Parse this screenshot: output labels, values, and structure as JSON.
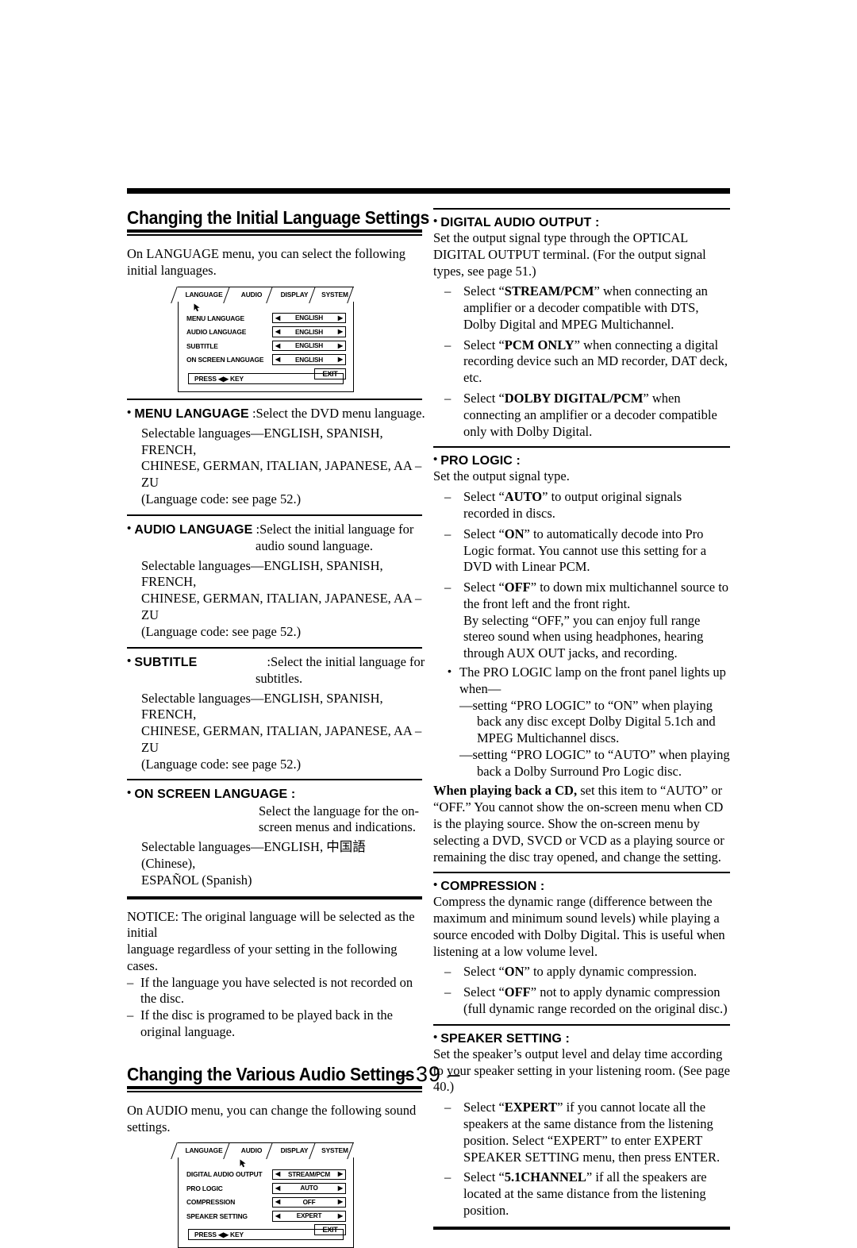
{
  "page": {
    "number_label": "– 39 –"
  },
  "left_column": {
    "heading": "Changing the Initial Language Settings",
    "intro": "On LANGUAGE menu, you can select the following initial languages.",
    "osd_language": {
      "tabs": [
        "LANGUAGE",
        "AUDIO",
        "DISPLAY",
        "SYSTEM"
      ],
      "active_tab": "LANGUAGE",
      "rows": [
        {
          "label": "MENU LANGUAGE",
          "value": "ENGLISH"
        },
        {
          "label": "AUDIO LANGUAGE",
          "value": "ENGLISH"
        },
        {
          "label": "SUBTITLE",
          "value": "ENGLISH"
        },
        {
          "label": "ON SCREEN LANGUAGE",
          "value": "ENGLISH"
        }
      ],
      "exit_label": "EXIT",
      "footer": "PRESS ◀▶ KEY",
      "left_arrow": "◀",
      "right_arrow": "▶"
    },
    "entries": [
      {
        "bullet": "•",
        "term": "MENU LANGUAGE",
        "defn": ":Select the DVD menu language.",
        "defn_cont": "",
        "list_line1": "Selectable languages—ENGLISH, SPANISH, FRENCH,",
        "list_line2": "CHINESE, GERMAN, ITALIAN, JAPANESE, AA – ZU",
        "list_line3": "(Language code: see page 52.)"
      },
      {
        "bullet": "•",
        "term": "AUDIO LANGUAGE",
        "defn": ":Select the initial language for",
        "defn_cont": "audio sound language.",
        "list_line1": "Selectable languages—ENGLISH, SPANISH, FRENCH,",
        "list_line2": "CHINESE, GERMAN, ITALIAN, JAPANESE, AA – ZU",
        "list_line3": "(Language code: see page 52.)"
      },
      {
        "bullet": "•",
        "term": "SUBTITLE",
        "defn": ":Select the initial language for",
        "defn_cont": "subtitles.",
        "list_line1": "Selectable languages—ENGLISH, SPANISH, FRENCH,",
        "list_line2": "CHINESE, GERMAN, ITALIAN, JAPANESE, AA – ZU",
        "list_line3": "(Language code: see page 52.)"
      }
    ],
    "on_screen_language": {
      "bullet": "•",
      "term": "ON SCREEN LANGUAGE :",
      "defn_line1": "Select the language for the on-",
      "defn_line2": "screen menus and indications.",
      "list_line1": "Selectable languages—ENGLISH, 中国語 (Chinese),",
      "list_line2": "ESPAÑOL (Spanish)"
    },
    "notice": {
      "line1": "NOTICE: The original language will be selected as the initial",
      "line2": "language regardless of your setting in the following cases.",
      "items": [
        {
          "dash": "–",
          "text": "If the language you have selected is not recorded on the disc."
        },
        {
          "dash": "–",
          "text": "If the disc is programed to be played back in the original language."
        }
      ]
    },
    "heading2": "Changing the Various Audio Settings",
    "intro2": "On AUDIO menu, you can change the following sound settings.",
    "osd_audio": {
      "tabs": [
        "LANGUAGE",
        "AUDIO",
        "DISPLAY",
        "SYSTEM"
      ],
      "active_tab": "AUDIO",
      "rows": [
        {
          "label": "DIGITAL AUDIO OUTPUT",
          "value": "STREAM/PCM"
        },
        {
          "label": "PRO LOGIC",
          "value": "AUTO"
        },
        {
          "label": "COMPRESSION",
          "value": "OFF"
        },
        {
          "label": "SPEAKER SETTING",
          "value": "EXPERT"
        }
      ],
      "exit_label": "EXIT",
      "footer": "PRESS ◀▶ KEY",
      "left_arrow": "◀",
      "right_arrow": "▶"
    }
  },
  "right_column": {
    "digital_audio_output": {
      "bullet": "•",
      "title": "DIGITAL AUDIO OUTPUT :",
      "body": "Set the output signal type through the OPTICAL DIGITAL OUTPUT terminal. (For the output signal types, see page 51.)",
      "items": [
        {
          "dash": "–",
          "pre": "Select “",
          "strong": "STREAM/PCM",
          "post": "” when connecting an amplifier or a decoder compatible with DTS, Dolby Digital and MPEG Multichannel."
        },
        {
          "dash": "–",
          "pre": "Select “",
          "strong": "PCM ONLY",
          "post": "” when connecting a digital recording device such an MD recorder, DAT deck, etc."
        },
        {
          "dash": "–",
          "pre": "Select “",
          "strong": "DOLBY DIGITAL/PCM",
          "post": "” when connecting an amplifier or a decoder compatible only with Dolby Digital."
        }
      ]
    },
    "pro_logic": {
      "bullet": "•",
      "title": "PRO LOGIC :",
      "body": "Set the output signal type.",
      "items": [
        {
          "dash": "–",
          "pre": "Select “",
          "strong": "AUTO",
          "post": "” to output original signals recorded in discs."
        },
        {
          "dash": "–",
          "pre": "Select “",
          "strong": "ON",
          "post": "” to automatically decode into Pro Logic format. You cannot use this setting for a DVD with Linear PCM."
        },
        {
          "dash": "–",
          "pre": "Select “",
          "strong": "OFF",
          "post": "” to down mix multichannel source to the front left and the front right."
        }
      ],
      "off_note": "By selecting “OFF,” you can enjoy full range stereo sound when using headphones, hearing through AUX OUT jacks, and recording.",
      "lamp_bullet": "•",
      "lamp_note": "The PRO LOGIC lamp on the front panel lights up when—",
      "lamp_items": [
        "—setting “PRO LOGIC” to “ON” when playing back any disc except Dolby Digital 5.1ch and MPEG Multichannel discs.",
        "—setting “PRO LOGIC” to “AUTO” when playing back a Dolby Surround Pro Logic disc."
      ],
      "cd_note_bold": "When playing back a CD,",
      "cd_note_rest": " set this item to “AUTO” or “OFF.” You cannot show the on-screen menu when CD is the playing source. Show the on-screen menu by selecting a DVD, SVCD or VCD as a playing source or remaining the disc tray opened, and change the setting."
    },
    "compression": {
      "bullet": "•",
      "title": "COMPRESSION :",
      "body": "Compress the dynamic range (difference between the maximum and minimum sound levels) while playing a source encoded with Dolby Digital. This is useful when listening at a low volume level.",
      "items": [
        {
          "dash": "–",
          "pre": "Select “",
          "strong": "ON",
          "post": "” to apply dynamic compression."
        },
        {
          "dash": "–",
          "pre": "Select “",
          "strong": "OFF",
          "post": "” not to apply dynamic compression (full dynamic range recorded on the original disc.)"
        }
      ]
    },
    "speaker_setting": {
      "bullet": "•",
      "title": "SPEAKER SETTING :",
      "body": "Set the speaker’s output level and delay time according to your speaker setting in your listening room. (See page 40.)",
      "items": [
        {
          "dash": "–",
          "pre": "Select “",
          "strong": "EXPERT",
          "post": "” if you cannot locate all the speakers at the same distance from the listening position. Select “EXPERT” to enter EXPERT SPEAKER SETTING menu, then press ENTER."
        },
        {
          "dash": "–",
          "pre": "Select “",
          "strong": "5.1CHANNEL",
          "post": "” if all the speakers are located at the same distance from the listening position."
        }
      ]
    }
  }
}
